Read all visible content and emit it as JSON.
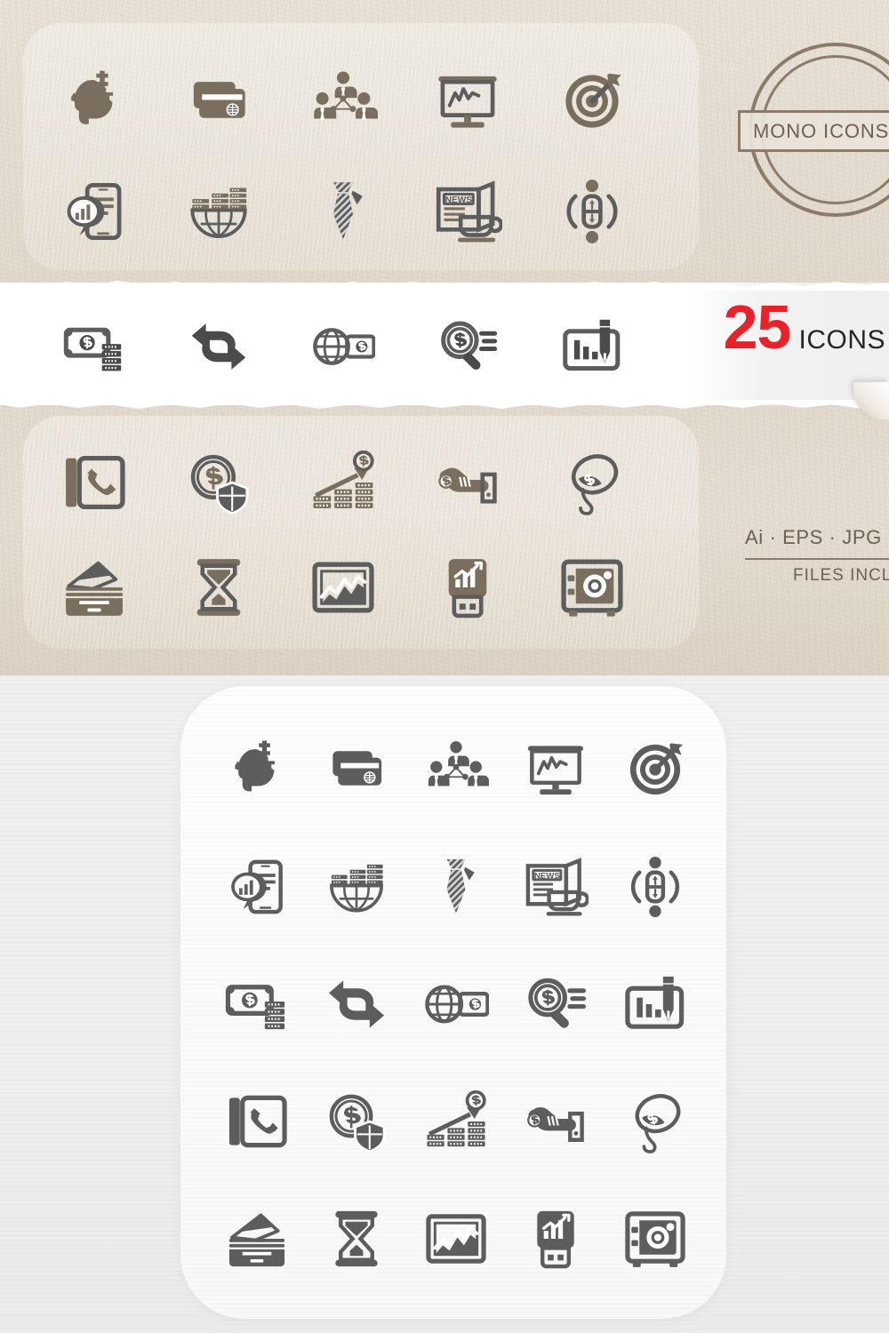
{
  "product": {
    "stamp_label": "MONO ICONS ·",
    "count_number": "25",
    "count_word": "ICONS",
    "formats_line": "Ai · EPS · JPG · S",
    "files_included_line": "FILES INCLU"
  },
  "colors": {
    "accent_red": "#e8222a",
    "kraft_background": "#e5ded2",
    "kraft_icon": "#7a6f5e",
    "stamp_brown": "#8c7b68",
    "banner_white": "#ffffff",
    "dark_icon": "#4b4b4b",
    "bottom_background": "#ececec",
    "card_white": "#fdfdfd"
  },
  "icons": [
    {
      "id": "head-dollar-key",
      "name": "head-with-dollar-key-icon",
      "label": "Business Idea"
    },
    {
      "id": "credit-cards",
      "name": "credit-cards-globe-icon",
      "label": "Credit Cards"
    },
    {
      "id": "team-network",
      "name": "team-network-icon",
      "label": "Team Network"
    },
    {
      "id": "presentation",
      "name": "presentation-chart-icon",
      "label": "Presentation"
    },
    {
      "id": "target-dart",
      "name": "target-dart-icon",
      "label": "Target"
    },
    {
      "id": "mobile-analytics",
      "name": "mobile-analytics-icon",
      "label": "Mobile Analytics"
    },
    {
      "id": "global-money",
      "name": "global-money-stacks-icon",
      "label": "Global Finance"
    },
    {
      "id": "necktie",
      "name": "necktie-icon",
      "label": "Necktie"
    },
    {
      "id": "news-coffee",
      "name": "newspaper-coffee-icon",
      "label": "News & Coffee"
    },
    {
      "id": "person-connect",
      "name": "person-connection-icon",
      "label": "Connection"
    },
    {
      "id": "cash-coins",
      "name": "banknote-coins-icon",
      "label": "Cash"
    },
    {
      "id": "exchange",
      "name": "exchange-arrows-icon",
      "label": "Exchange"
    },
    {
      "id": "globe-money",
      "name": "globe-banknote-icon",
      "label": "Global Money"
    },
    {
      "id": "search-money",
      "name": "magnifier-dollar-icon",
      "label": "Money Search"
    },
    {
      "id": "chart-pen",
      "name": "chart-pen-icon",
      "label": "Report"
    },
    {
      "id": "phone-book",
      "name": "phone-book-icon",
      "label": "Phone Book"
    },
    {
      "id": "coin-shield",
      "name": "dollar-coin-shield-icon",
      "label": "Secure Money"
    },
    {
      "id": "growth-coins",
      "name": "growth-arrow-coins-icon",
      "label": "Growth"
    },
    {
      "id": "hand-coin",
      "name": "hand-with-coin-icon",
      "label": "Payment"
    },
    {
      "id": "money-balloon",
      "name": "money-balloon-icon",
      "label": "Inflation"
    },
    {
      "id": "wallet-cards",
      "name": "wallet-cards-icon",
      "label": "Wallet"
    },
    {
      "id": "hourglass",
      "name": "hourglass-icon",
      "label": "Time"
    },
    {
      "id": "chart-frame",
      "name": "chart-picture-frame-icon",
      "label": "Statistics"
    },
    {
      "id": "usb-chart",
      "name": "usb-chart-icon",
      "label": "Data Storage"
    },
    {
      "id": "safe-vault",
      "name": "safe-vault-icon",
      "label": "Safe"
    }
  ],
  "layout": {
    "top_panel_rows": 2,
    "strip_row": 1,
    "mid_panel_rows": 2,
    "bottom_grid_rows": 5,
    "bottom_grid_cols": 5
  }
}
